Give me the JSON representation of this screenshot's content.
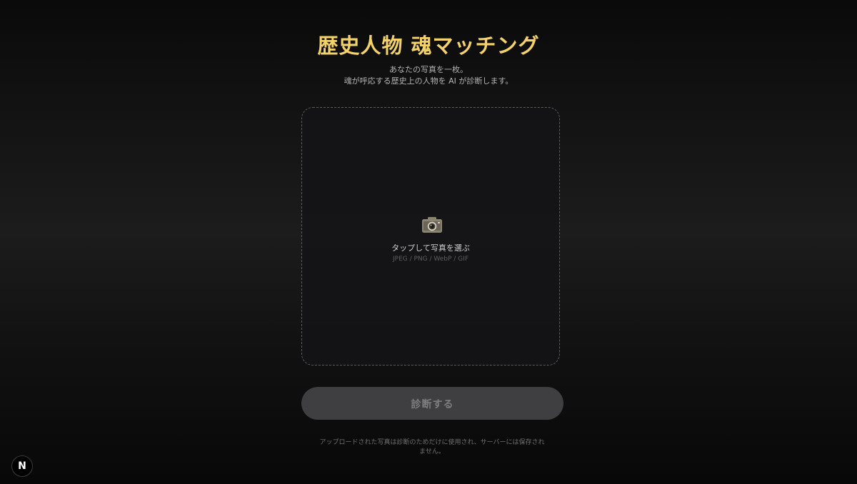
{
  "header": {
    "title": "歴史人物 魂マッチング",
    "subtitle_line1": "あなたの写真を一枚。",
    "subtitle_line2": "魂が呼応する歴史上の人物を AI が診断します。"
  },
  "upload": {
    "icon": "camera-icon",
    "label": "タップして写真を選ぶ",
    "formats": "JPEG / PNG / WebP / GIF"
  },
  "actions": {
    "diagnose_label": "診断する"
  },
  "footer": {
    "notice": "アップロードされた写真は診断のためだけに使用され、サーバーには保存されません。"
  },
  "dev_badge": {
    "letter": "N"
  },
  "colors": {
    "title_gold": "#f3d26a",
    "button_disabled_bg": "#3f3f41",
    "button_disabled_text": "#7e7e80"
  }
}
